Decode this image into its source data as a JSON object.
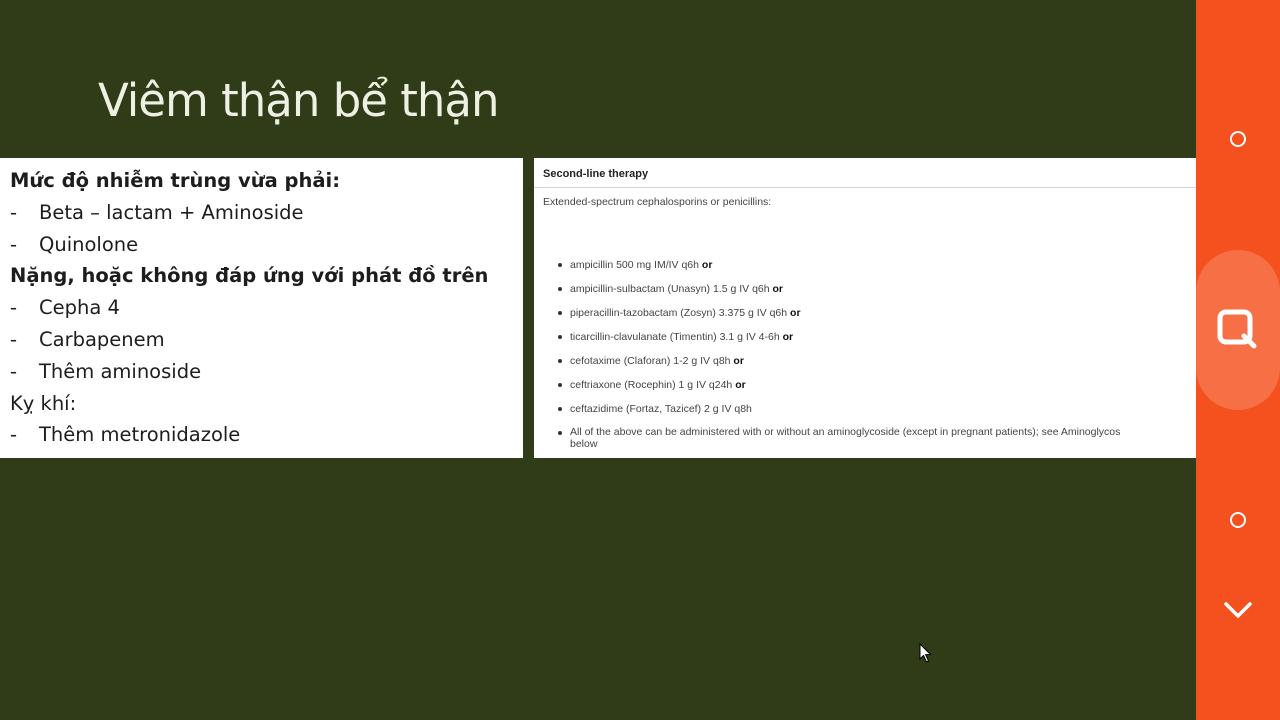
{
  "slide": {
    "title": "Viêm thận bể thận",
    "left_panel": {
      "lines": [
        {
          "type": "heading",
          "text": "Mức độ nhiễm trùng vừa phải:"
        },
        {
          "type": "bullet",
          "dash": "-",
          "text": "Beta – lactam + Aminoside"
        },
        {
          "type": "bullet",
          "dash": "-",
          "text": "Quinolone"
        },
        {
          "type": "heading",
          "text": "Nặng, hoặc không đáp ứng với phát đồ trên"
        },
        {
          "type": "bullet",
          "dash": "-",
          "text": "Cepha 4"
        },
        {
          "type": "bullet",
          "dash": "-",
          "text": "Carbapenem"
        },
        {
          "type": "bullet",
          "dash": "-",
          "text": "Thêm aminoside"
        },
        {
          "type": "plain",
          "text": "Kỵ khí:"
        },
        {
          "type": "bullet",
          "dash": "-",
          "text": "Thêm metronidazole"
        }
      ]
    },
    "right_panel": {
      "header": "Second-line therapy",
      "intro": "Extended-spectrum cephalosporins or penicillins:",
      "items": [
        {
          "text": "ampicillin 500 mg IM/IV q6h",
          "suffix": "or"
        },
        {
          "text": "ampicillin-sulbactam (Unasyn) 1.5 g IV q6h",
          "suffix": "or"
        },
        {
          "text": "piperacillin-tazobactam (Zosyn) 3.375 g IV q6h",
          "suffix": "or"
        },
        {
          "text": "ticarcillin-clavulanate (Timentin) 3.1 g IV 4-6h",
          "suffix": "or"
        },
        {
          "text": "cefotaxime (Claforan) 1-2 g IV q8h",
          "suffix": "or"
        },
        {
          "text": "ceftriaxone (Rocephin) 1 g IV q24h",
          "suffix": "or"
        },
        {
          "text": "ceftazidime (Fortaz, Tazicef) 2 g IV q8h",
          "suffix": ""
        }
      ],
      "last_item": {
        "text": "All of the above can be administered with or without an aminoglycoside (except in pregnant patients); see Aminoglycos",
        "continuation": "below"
      }
    }
  },
  "side_panel": {
    "buttons": [
      {
        "name": "circle-button-top",
        "icon": "circle-icon"
      },
      {
        "name": "zoom-button",
        "icon": "magnify-square-icon"
      },
      {
        "name": "circle-button-bottom",
        "icon": "circle-icon"
      },
      {
        "name": "collapse-button",
        "icon": "chevron-down-icon"
      }
    ]
  },
  "colors": {
    "slide_background": "#2f3c17",
    "title_text": "#eef0e4",
    "panel_background": "#ffffff",
    "side_panel": "#f4511e",
    "side_panel_highlight": "#f66f45"
  }
}
